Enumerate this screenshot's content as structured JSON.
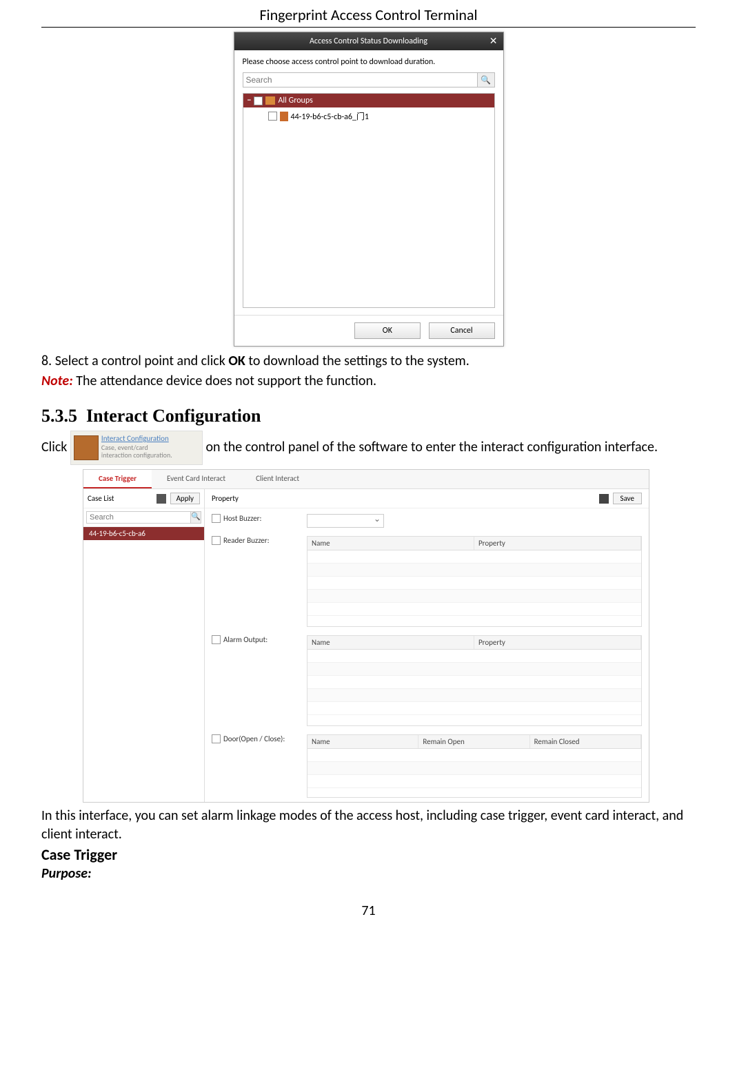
{
  "header": {
    "title": "Fingerprint Access Control Terminal"
  },
  "footer": {
    "page_number": "71"
  },
  "dialog": {
    "title": "Access Control Status Downloading",
    "close_glyph": "✕",
    "instruction": "Please choose access control point to download duration.",
    "search_placeholder": "Search",
    "search_glyph": "🔍",
    "tree_root": "All Groups",
    "tree_child": "44-19-b6-c5-cb-a6_门1",
    "ok": "OK",
    "cancel": "Cancel"
  },
  "step8": {
    "num": "8.",
    "text_a": "Select a control point and click ",
    "text_b": "OK",
    "text_c": " to download the settings to the system."
  },
  "note": {
    "label": "Note:",
    "text": " The attendance device does not support the function."
  },
  "section": {
    "num": "5.3.5",
    "title": "Interact Configuration"
  },
  "icon_btn": {
    "title": "Interact Configuration",
    "sub1": "Case, event/card",
    "sub2": "interaction configuration."
  },
  "click_line": {
    "a": "Click ",
    "b": " on the control panel of the software to enter the interact configuration interface."
  },
  "shot2": {
    "tabs": {
      "t1": "Case Trigger",
      "t2": "Event Card Interact",
      "t3": "Client Interact"
    },
    "left": {
      "case_list": "Case List",
      "apply": "Apply",
      "search_placeholder": "Search",
      "search_glyph": "🔍",
      "node": "44-19-b6-c5-cb-a6"
    },
    "right": {
      "property": "Property",
      "save": "Save",
      "host_buzzer": "Host Buzzer:",
      "reader_buzzer": "Reader Buzzer:",
      "alarm_output": "Alarm Output:",
      "door": "Door(Open / Close):",
      "grid1": {
        "c1": "Name",
        "c2": "Property"
      },
      "grid2": {
        "c1": "Name",
        "c2": "Property"
      },
      "grid3": {
        "c1": "Name",
        "c2": "Remain Open",
        "c3": "Remain Closed"
      }
    }
  },
  "after_shot2": "In this interface, you can set alarm linkage modes of the access host, including case trigger, event card interact, and client interact.",
  "case_trigger": "Case Trigger",
  "purpose": "Purpose:"
}
